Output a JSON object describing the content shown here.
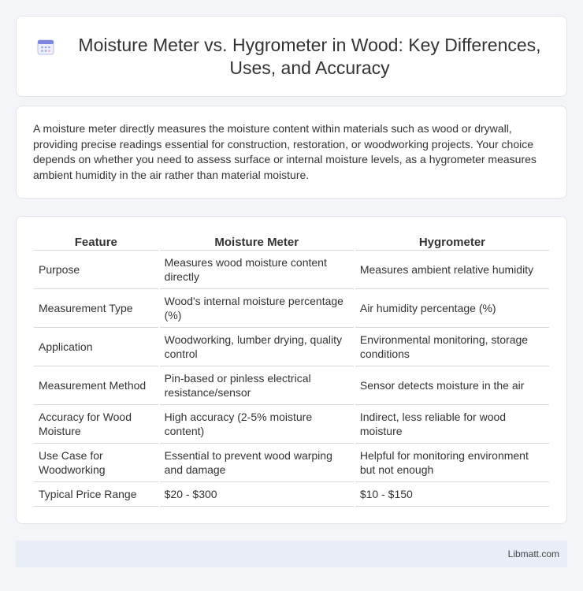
{
  "header": {
    "icon": "calendar-icon",
    "title": "Moisture Meter vs. Hygrometer in Wood: Key Differences, Uses, and Accuracy"
  },
  "intro": {
    "text": "A moisture meter directly measures the moisture content within materials such as wood or drywall, providing precise readings essential for construction, restoration, or woodworking projects. Your choice depends on whether you need to assess surface or internal moisture levels, as a hygrometer measures ambient humidity in the air rather than material moisture."
  },
  "table": {
    "headers": [
      "Feature",
      "Moisture Meter",
      "Hygrometer"
    ],
    "rows": [
      [
        "Purpose",
        "Measures wood moisture content directly",
        "Measures ambient relative humidity"
      ],
      [
        "Measurement Type",
        "Wood's internal moisture percentage (%)",
        "Air humidity percentage (%)"
      ],
      [
        "Application",
        "Woodworking, lumber drying, quality control",
        "Environmental monitoring, storage conditions"
      ],
      [
        "Measurement Method",
        "Pin-based or pinless electrical resistance/sensor",
        "Sensor detects moisture in the air"
      ],
      [
        "Accuracy for Wood Moisture",
        "High accuracy (2-5% moisture content)",
        "Indirect, less reliable for wood moisture"
      ],
      [
        "Use Case for Woodworking",
        "Essential to prevent wood warping and damage",
        "Helpful for monitoring environment but not enough"
      ],
      [
        "Typical Price Range",
        "$20 - $300",
        "$10 - $150"
      ]
    ]
  },
  "footer": {
    "brand": "Libmatt.com"
  },
  "colors": {
    "background": "#f4f5f9",
    "card": "#ffffff",
    "footer": "#e9edf7",
    "icon_accent": "#7b86e0"
  }
}
